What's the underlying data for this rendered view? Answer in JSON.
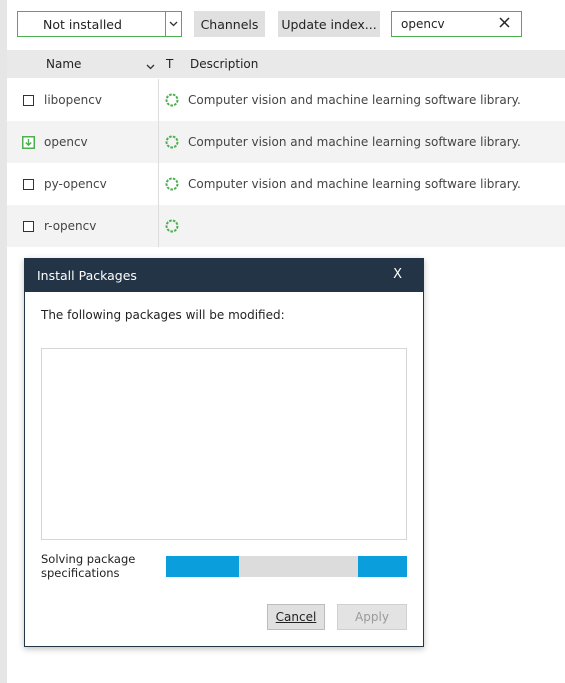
{
  "toolbar": {
    "filter_select": {
      "value": "Not installed",
      "icon": "chevron-down-icon"
    },
    "channels_label": "Channels",
    "update_index_label": "Update index...",
    "search": {
      "value": "opencv",
      "clear_icon": "close-icon"
    }
  },
  "table": {
    "headers": {
      "name": "Name",
      "type": "T",
      "description": "Description"
    },
    "rows": [
      {
        "name": "libopencv",
        "status": "not-installed",
        "description": "Computer vision and machine learning software library."
      },
      {
        "name": "opencv",
        "status": "marked-for-install",
        "description": "Computer vision and machine learning software library."
      },
      {
        "name": "py-opencv",
        "status": "not-installed",
        "description": "Computer vision and machine learning software library."
      },
      {
        "name": "r-opencv",
        "status": "not-installed",
        "description": ""
      }
    ]
  },
  "dialog": {
    "title": "Install Packages",
    "close_label": "X",
    "message": "The following packages will be modified:",
    "status_text": "Solving package specifications",
    "progress_state": "indeterminate",
    "cancel_label": "Cancel",
    "apply_label": "Apply"
  },
  "colors": {
    "accent_green": "#4caf50",
    "dialog_titlebar": "#243447",
    "progress_blue": "#0a9fdc"
  }
}
